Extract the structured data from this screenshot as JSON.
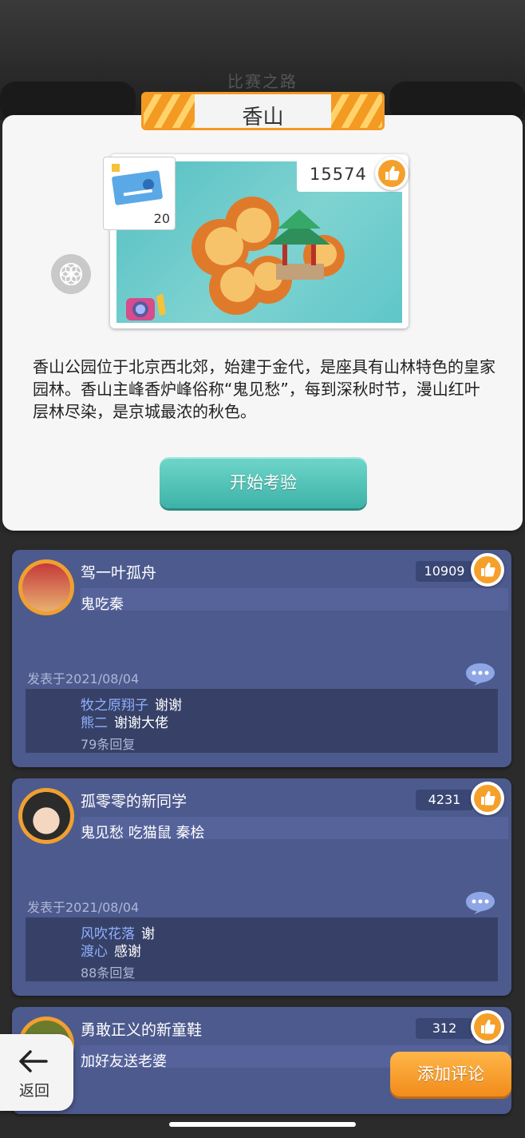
{
  "background": {
    "title": "比赛之路"
  },
  "location": {
    "title": "香山",
    "likes": "15574",
    "ticket_count": "20",
    "description": "香山公园位于北京西北郊，始建于金代，是座具有山林特色的皇家园林。香山主峰香炉峰俗称“鬼见愁”，每到深秋时节，漫山红叶层林尽染，是京城最浓的秋色。",
    "start_button": "开始考验"
  },
  "comments": [
    {
      "user": "驾一叶孤舟",
      "text": "鬼吃秦",
      "likes": "10909",
      "date": "发表于2021/08/04",
      "replies": [
        {
          "user": "牧之原翔子",
          "msg": "谢谢"
        },
        {
          "user": "熊二",
          "msg": "谢谢大佬"
        }
      ],
      "reply_count": "79条回复"
    },
    {
      "user": "孤零零的新同学",
      "text": "鬼见愁 吃猫鼠 秦桧",
      "likes": "4231",
      "date": "发表于2021/08/04",
      "replies": [
        {
          "user": "风吹花落",
          "msg": "谢"
        },
        {
          "user": "渡心",
          "msg": "感谢"
        }
      ],
      "reply_count": "88条回复"
    },
    {
      "user": "勇敢正义的新童鞋",
      "text": "加好友送老婆",
      "likes": "312"
    }
  ],
  "back_button": "返回",
  "add_comment_button": "添加评论",
  "colors": {
    "accent": "#f5a02a",
    "teal": "#3eb2a8",
    "panel": "#4d5a8e"
  }
}
